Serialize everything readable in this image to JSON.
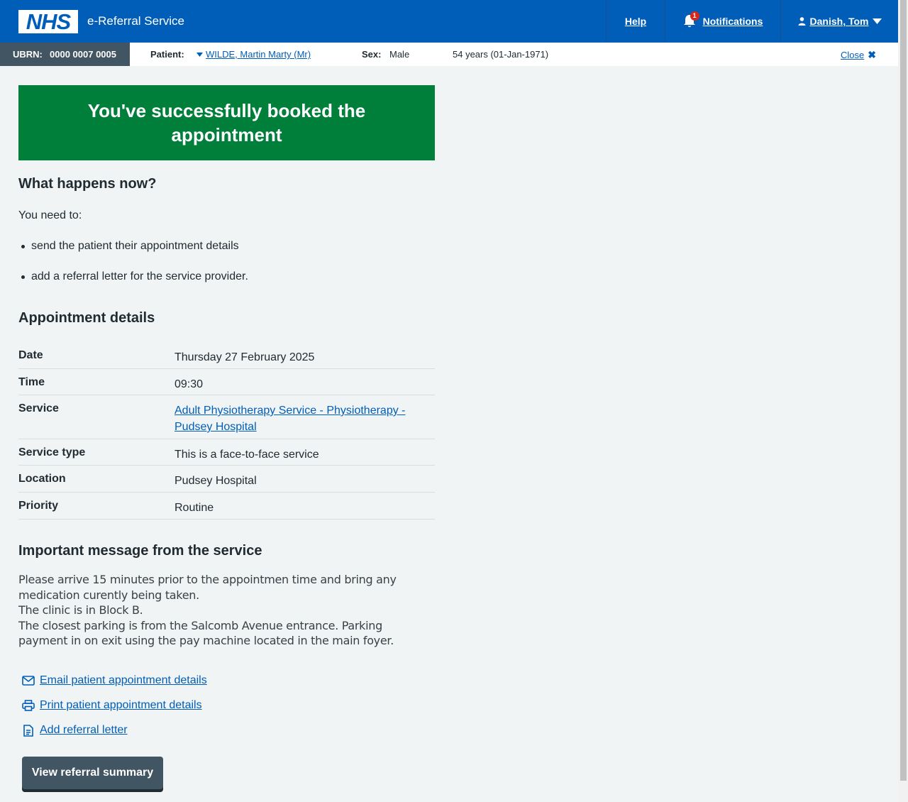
{
  "header": {
    "logo_text": "NHS",
    "service_name": "e-Referral Service",
    "help_label": "Help",
    "notifications_label": "Notifications",
    "notification_count": "1",
    "user_name": "Danish, Tom"
  },
  "banner": {
    "ubrn_label": "UBRN:",
    "ubrn_value": "0000 0007 0005",
    "patient_label": "Patient:",
    "patient_name": "WILDE, Martin Marty (Mr)",
    "sex_label": "Sex:",
    "sex_value": "Male",
    "age_dob": "54 years (01-Jan-1971)",
    "close_label": "Close"
  },
  "success": {
    "title": "You've successfully booked the appointment"
  },
  "next_steps": {
    "heading": "What happens now?",
    "intro": "You need to:",
    "items": [
      "send the patient their appointment details",
      "add a referral letter for the service provider."
    ]
  },
  "appointment": {
    "heading": "Appointment details",
    "rows": [
      {
        "label": "Date",
        "value": "Thursday 27 February 2025"
      },
      {
        "label": "Time",
        "value": "09:30"
      },
      {
        "label": "Service",
        "value": "Adult Physiotherapy Service - Physiotherapy - Pudsey Hospital"
      },
      {
        "label": "Service type",
        "value": "This is a face-to-face service"
      },
      {
        "label": "Location",
        "value": "Pudsey Hospital"
      },
      {
        "label": "Priority",
        "value": "Routine"
      }
    ]
  },
  "message": {
    "heading": "Important message from the service",
    "lines": [
      "Please arrive 15 minutes prior to the appointmen time and bring any medication curently being taken.",
      "The clinic is in Block B.",
      "The closest parking is from the Salcomb Avenue entrance. Parking payment in on exit using the pay machine located in the main foyer."
    ]
  },
  "actions": {
    "email": "Email patient appointment details",
    "print": "Print patient appointment details",
    "letter": "Add referral letter",
    "view_summary": "View referral summary"
  },
  "colors": {
    "nhs_blue": "#005eb8",
    "success_green": "#007f3b",
    "dark_grey": "#425563"
  }
}
